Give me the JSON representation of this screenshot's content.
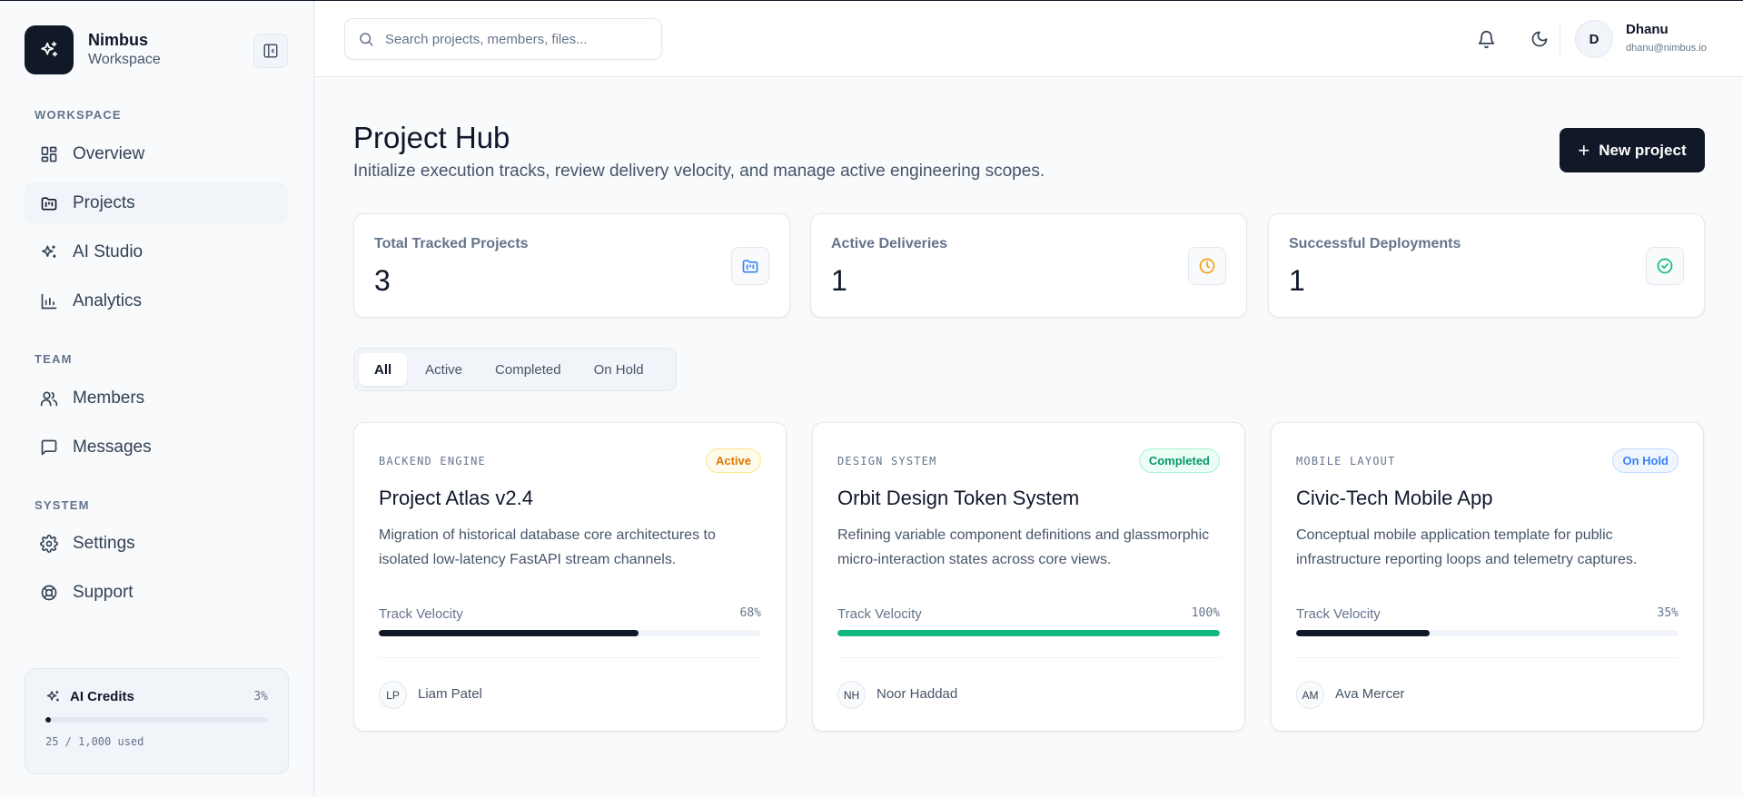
{
  "brand": {
    "name": "Nimbus",
    "subtitle": "Workspace"
  },
  "sidebar": {
    "sections": [
      {
        "label": "WORKSPACE",
        "items": [
          {
            "label": "Overview",
            "icon": "grid-icon"
          },
          {
            "label": "Projects",
            "icon": "folder-kanban-icon",
            "active": true
          },
          {
            "label": "AI Studio",
            "icon": "sparkles-icon"
          },
          {
            "label": "Analytics",
            "icon": "bar-chart-icon"
          }
        ]
      },
      {
        "label": "TEAM",
        "items": [
          {
            "label": "Members",
            "icon": "users-icon"
          },
          {
            "label": "Messages",
            "icon": "message-square-icon"
          }
        ]
      },
      {
        "label": "SYSTEM",
        "items": [
          {
            "label": "Settings",
            "icon": "gear-icon"
          },
          {
            "label": "Support",
            "icon": "lifebuoy-icon"
          }
        ]
      }
    ],
    "credits": {
      "title": "AI Credits",
      "percent_label": "3%",
      "used_fraction": 0.025,
      "used_label": "25 / 1,000 used"
    }
  },
  "topbar": {
    "search_placeholder": "Search projects, members, files...",
    "user": {
      "initial": "D",
      "name": "Dhanu",
      "email": "dhanu@nimbus.io"
    }
  },
  "main": {
    "title": "Project Hub",
    "subtitle": "Initialize execution tracks, review delivery velocity, and manage active engineering scopes.",
    "new_button_label": "New project",
    "stats": [
      {
        "label": "Total Tracked Projects",
        "value": "3",
        "icon": "folder-kanban-icon",
        "color": "#3b82f6"
      },
      {
        "label": "Active Deliveries",
        "value": "1",
        "icon": "clock-icon",
        "color": "#f59e0b"
      },
      {
        "label": "Successful Deployments",
        "value": "1",
        "icon": "check-circle-icon",
        "color": "#10b981"
      }
    ],
    "filters": [
      "All",
      "Active",
      "Completed",
      "On Hold"
    ],
    "selected_filter": "All",
    "projects": [
      {
        "category": "BACKEND ENGINE",
        "status": "Active",
        "status_colors": {
          "bg": "#fffbeb",
          "border": "#fde68a",
          "text": "#d97706"
        },
        "title": "Project Atlas v2.4",
        "description": "Migration of historical database core architectures to isolated low-latency FastAPI stream channels.",
        "velocity_label": "Track Velocity",
        "velocity_pct_label": "68%",
        "velocity": 0.68,
        "bar_color": "#111827",
        "owner_initials": "LP",
        "owner_name": "Liam Patel"
      },
      {
        "category": "DESIGN SYSTEM",
        "status": "Completed",
        "status_colors": {
          "bg": "#ecfdf5",
          "border": "#a7f3d0",
          "text": "#059669"
        },
        "title": "Orbit Design Token System",
        "description": "Refining variable component definitions and glassmorphic micro-interaction states across core views.",
        "velocity_label": "Track Velocity",
        "velocity_pct_label": "100%",
        "velocity": 1.0,
        "bar_color": "#10b981",
        "owner_initials": "NH",
        "owner_name": "Noor Haddad"
      },
      {
        "category": "MOBILE LAYOUT",
        "status": "On Hold",
        "status_colors": {
          "bg": "#eff6ff",
          "border": "#bfdbfe",
          "text": "#3b82f6"
        },
        "title": "Civic-Tech Mobile App",
        "description": "Conceptual mobile application template for public infrastructure reporting loops and telemetry captures.",
        "velocity_label": "Track Velocity",
        "velocity_pct_label": "35%",
        "velocity": 0.35,
        "bar_color": "#111827",
        "owner_initials": "AM",
        "owner_name": "Ava Mercer"
      }
    ]
  }
}
